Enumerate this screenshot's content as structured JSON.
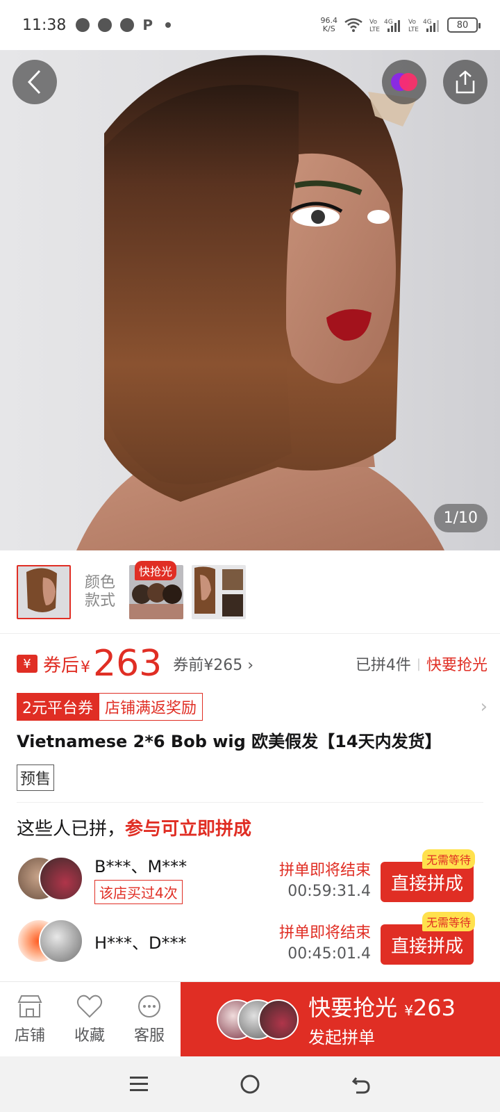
{
  "status": {
    "time": "11:38",
    "net_speed": "96.4",
    "net_unit": "K/S",
    "battery": "80"
  },
  "gallery": {
    "counter": "1/10"
  },
  "thumbs": {
    "label_line1": "颜色",
    "label_line2": "款式",
    "tag": "快抢光"
  },
  "price": {
    "after_label": "券后",
    "currency": "¥",
    "value": "263",
    "before": "券前¥265",
    "sold": "已拼4件",
    "rush": "快要抢光"
  },
  "coupons": {
    "platform": "2元平台券",
    "store": "店铺满返奖励"
  },
  "product": {
    "title": "Vietnamese 2*6 Bob wig 欧美假发【14天内发货】",
    "presale": "预售"
  },
  "group": {
    "header_plain": "这些人已拼，",
    "header_highlight": "参与可立即拼成",
    "rows": [
      {
        "names": "B***、M***",
        "tag": "该店买过4次",
        "ending": "拼单即将结束",
        "time": "00:59:31.4",
        "button": "直接拼成",
        "badge": "无需等待"
      },
      {
        "names": "H***、D***",
        "tag": "",
        "ending": "拼单即将结束",
        "time": "00:45:01.4",
        "button": "直接拼成",
        "badge": "无需等待"
      }
    ]
  },
  "bottom": {
    "store": "店铺",
    "favorite": "收藏",
    "service": "客服",
    "buy_main": "快要抢光",
    "buy_currency": "¥",
    "buy_price": "263",
    "buy_sub": "发起拼单"
  },
  "colors": {
    "accent": "#e02e24",
    "badge_yellow": "#ffe14d"
  }
}
